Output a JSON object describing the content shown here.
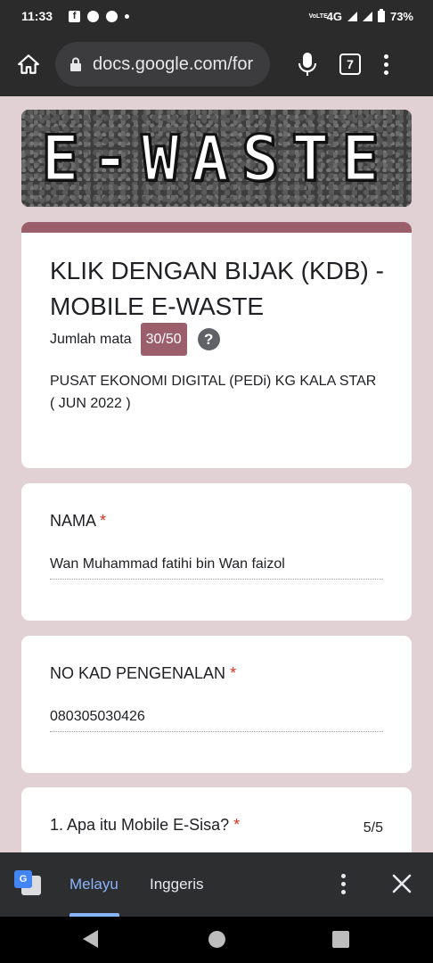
{
  "status_bar": {
    "time": "11:33",
    "network": "4G",
    "battery": "73%",
    "volte": "VoLTE"
  },
  "browser": {
    "url": "docs.google.com/for",
    "tab_count": "7"
  },
  "banner": {
    "text": "E-WASTE"
  },
  "form": {
    "title": "KLIK DENGAN BIJAK (KDB) - MOBILE E-WASTE",
    "points_label": "Jumlah mata",
    "points_value": "30/50",
    "help_symbol": "?",
    "description_line1": "PUSAT EKONOMI DIGITAL (PEDi) KG KALA STAR",
    "description_line2": "( JUN 2022 )"
  },
  "questions": [
    {
      "label": "NAMA",
      "required_mark": "*",
      "answer": "Wan Muhammad fatihi bin Wan faizol"
    },
    {
      "label": "NO KAD PENGENALAN",
      "required_mark": "*",
      "answer": "080305030426"
    },
    {
      "label": "1. Apa itu Mobile E-Sisa?",
      "required_mark": "*",
      "score": "5/5"
    }
  ],
  "translate_bar": {
    "lang_active": "Melayu",
    "lang_other": "Inggeris"
  },
  "colors": {
    "accent": "#9b5e6b",
    "page_bg": "#e1d0d4",
    "required": "#d93025",
    "translate_active": "#8ab4f8"
  },
  "icons": [
    "home-icon",
    "lock-icon",
    "mic-icon",
    "tabs-icon",
    "more-vert-icon",
    "help-icon",
    "google-translate-icon",
    "close-icon",
    "nav-back-icon",
    "nav-home-icon",
    "nav-recents-icon"
  ]
}
